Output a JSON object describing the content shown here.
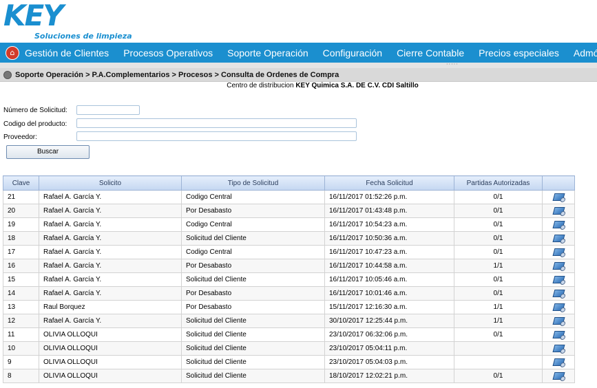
{
  "brand": {
    "name": "KEY",
    "tagline": "Soluciones de limpieza"
  },
  "menu": [
    "Gestión de Clientes",
    "Procesos Operativos",
    "Soporte Operación",
    "Configuración",
    "Cierre Contable",
    "Precios especiales",
    "Admón. de C"
  ],
  "breadcrumb": "Soporte Operación > P.A.Complementarios > Procesos > Consulta de Ordenes de Compra",
  "center": {
    "prefix": "Centro de distribucion",
    "name": "KEY Quimica S.A. DE C.V. CDI Saltillo"
  },
  "form": {
    "solicitud_label": "Número de Solicitud:",
    "solicitud_value": "",
    "producto_label": "Codigo del producto:",
    "producto_value": "",
    "proveedor_label": "Proveedor:",
    "proveedor_value": "",
    "search_button": "Buscar"
  },
  "table": {
    "columns": [
      "Clave",
      "Solicito",
      "Tipo de Solicitud",
      "Fecha Solicitud",
      "Partidas Autorizadas",
      ""
    ],
    "rows": [
      {
        "clave": "21",
        "solicito": "Rafael A. García Y.",
        "tipo": "Codigo Central",
        "fecha": "16/11/2017 01:52:26 p.m.",
        "partidas": "0/1"
      },
      {
        "clave": "20",
        "solicito": "Rafael A. García Y.",
        "tipo": "Por Desabasto",
        "fecha": "16/11/2017 01:43:48 p.m.",
        "partidas": "0/1"
      },
      {
        "clave": "19",
        "solicito": "Rafael A. García Y.",
        "tipo": "Codigo Central",
        "fecha": "16/11/2017 10:54:23 a.m.",
        "partidas": "0/1"
      },
      {
        "clave": "18",
        "solicito": "Rafael A. García Y.",
        "tipo": "Solicitud del Cliente",
        "fecha": "16/11/2017 10:50:36 a.m.",
        "partidas": "0/1"
      },
      {
        "clave": "17",
        "solicito": "Rafael A. García Y.",
        "tipo": "Codigo Central",
        "fecha": "16/11/2017 10:47:23 a.m.",
        "partidas": "0/1"
      },
      {
        "clave": "16",
        "solicito": "Rafael A. García Y.",
        "tipo": "Por Desabasto",
        "fecha": "16/11/2017 10:44:58 a.m.",
        "partidas": "1/1"
      },
      {
        "clave": "15",
        "solicito": "Rafael A. García Y.",
        "tipo": "Solicitud del Cliente",
        "fecha": "16/11/2017 10:05:46 a.m.",
        "partidas": "0/1"
      },
      {
        "clave": "14",
        "solicito": "Rafael A. García Y.",
        "tipo": "Por Desabasto",
        "fecha": "16/11/2017 10:01:46 a.m.",
        "partidas": "0/1"
      },
      {
        "clave": "13",
        "solicito": "Raul Borquez",
        "tipo": "Por Desabasto",
        "fecha": "15/11/2017 12:16:30 a.m.",
        "partidas": "1/1"
      },
      {
        "clave": "12",
        "solicito": "Rafael A. García Y.",
        "tipo": "Solicitud del Cliente",
        "fecha": "30/10/2017 12:25:44 p.m.",
        "partidas": "1/1"
      },
      {
        "clave": "11",
        "solicito": "OLIVIA OLLOQUI",
        "tipo": "Solicitud del Cliente",
        "fecha": "23/10/2017 06:32:06 p.m.",
        "partidas": "0/1"
      },
      {
        "clave": "10",
        "solicito": "OLIVIA OLLOQUI",
        "tipo": "Solicitud del Cliente",
        "fecha": "23/10/2017 05:04:11 p.m.",
        "partidas": ""
      },
      {
        "clave": "9",
        "solicito": "OLIVIA OLLOQUI",
        "tipo": "Solicitud del Cliente",
        "fecha": "23/10/2017 05:04:03 p.m.",
        "partidas": ""
      },
      {
        "clave": "8",
        "solicito": "OLIVIA OLLOQUI",
        "tipo": "Solicitud del Cliente",
        "fecha": "18/10/2017 12:02:21 p.m.",
        "partidas": "0/1"
      }
    ]
  },
  "colors": {
    "accent": "#1b8fcf",
    "home_icon": "#d23b2a",
    "row_icon": "#2c6db5"
  },
  "icons": {
    "home": "home-icon",
    "row_action": "document-search-icon"
  }
}
